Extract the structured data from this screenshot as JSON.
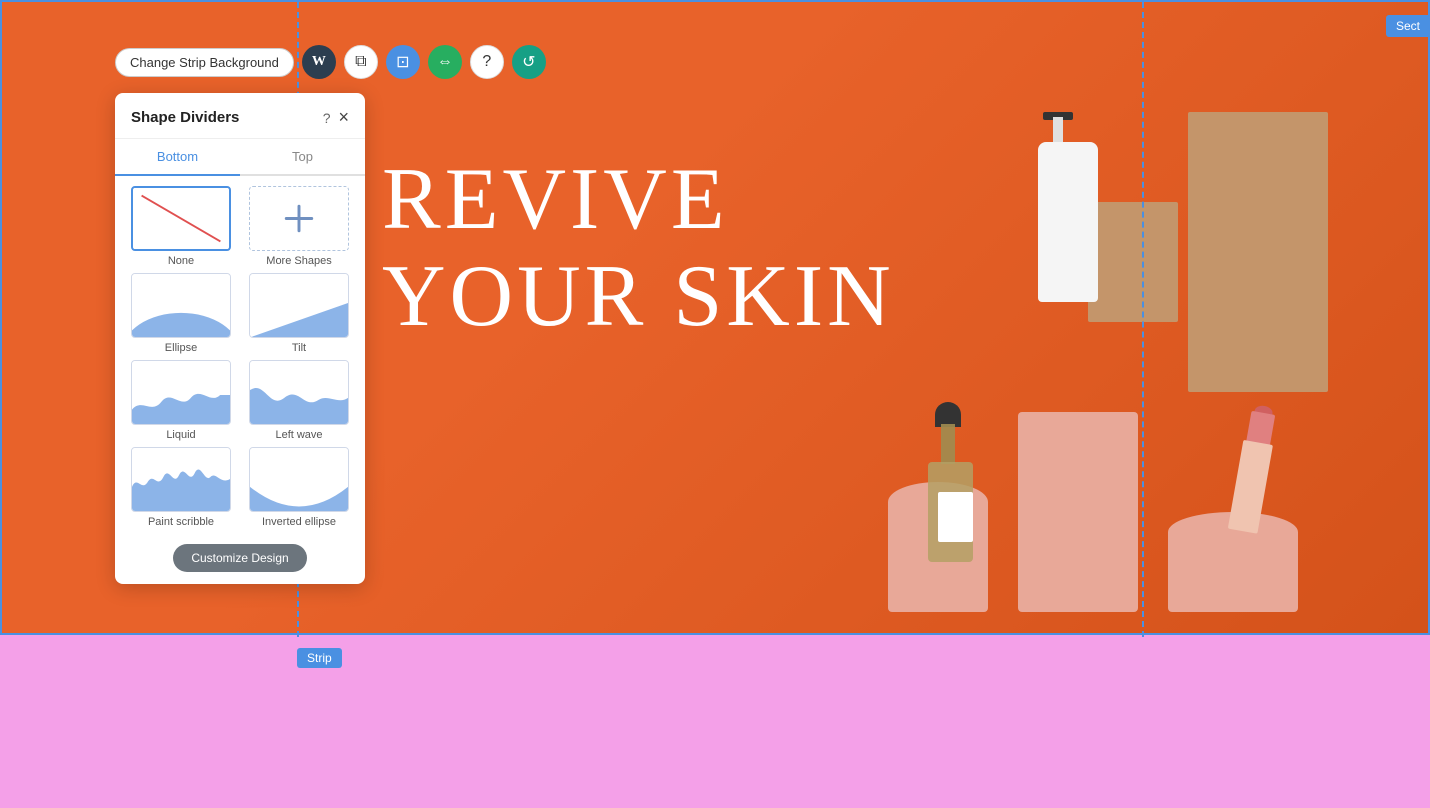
{
  "toolbar": {
    "change_background_label": "Change Strip Background",
    "icons": [
      {
        "name": "wix-logo-icon",
        "symbol": "⬡",
        "bg": "dark"
      },
      {
        "name": "copy-icon",
        "symbol": "⧉",
        "bg": "white"
      },
      {
        "name": "crop-icon",
        "symbol": "⊡",
        "bg": "blue"
      },
      {
        "name": "link-icon",
        "symbol": "⇔",
        "bg": "green"
      },
      {
        "name": "help-icon",
        "symbol": "?",
        "bg": "white"
      },
      {
        "name": "more-icon",
        "symbol": "↺",
        "bg": "teal"
      }
    ]
  },
  "sect_badge": {
    "label": "Sect"
  },
  "panel": {
    "title": "Shape Dividers",
    "help_icon": "?",
    "close_icon": "×",
    "tabs": [
      {
        "label": "Bottom",
        "active": true
      },
      {
        "label": "Top",
        "active": false
      }
    ],
    "shapes": [
      {
        "id": "none",
        "label": "None",
        "type": "none",
        "selected": true
      },
      {
        "id": "more-shapes",
        "label": "More Shapes",
        "type": "more"
      },
      {
        "id": "ellipse",
        "label": "Ellipse",
        "type": "ellipse",
        "selected": false
      },
      {
        "id": "tilt",
        "label": "Tilt",
        "type": "tilt",
        "selected": false
      },
      {
        "id": "liquid",
        "label": "Liquid",
        "type": "liquid",
        "selected": false
      },
      {
        "id": "left-wave",
        "label": "Left wave",
        "type": "leftwave",
        "selected": false
      },
      {
        "id": "paint-scribble",
        "label": "Paint scribble",
        "type": "paintscribble",
        "selected": false
      },
      {
        "id": "inverted-ellipse",
        "label": "Inverted ellipse",
        "type": "invertedellipse",
        "selected": false
      }
    ],
    "customize_btn_label": "Customize Design"
  },
  "hero": {
    "line1": "REVIVE",
    "line2": "YOUR SKIN"
  },
  "strip_label": "Strip",
  "colors": {
    "hero_bg": "#e8622a",
    "panel_bg": "#ffffff",
    "tab_active": "#4a90e2",
    "shape_fill": "#8cb4e8",
    "pink_strip": "#f4a0e8"
  }
}
